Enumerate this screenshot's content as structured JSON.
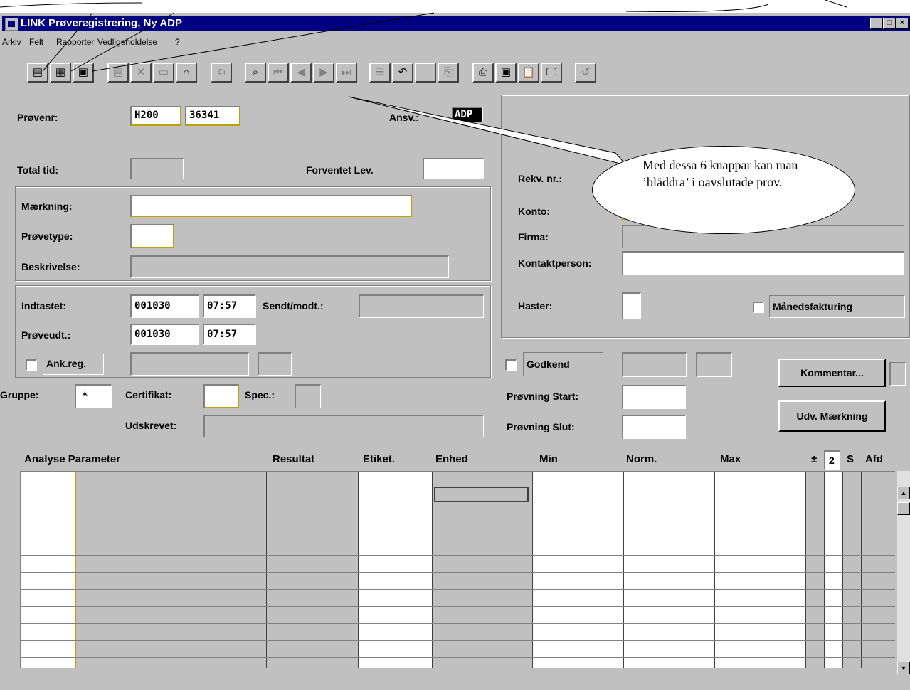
{
  "window": {
    "title": "LINK Prøveregistrering, Ny ADP",
    "menu": [
      "Arkiv",
      "Felt",
      "Rapporter",
      "Vedligeholdelse",
      "?"
    ]
  },
  "toolbar": {
    "buttons": [
      "new-doc",
      "calendar",
      "copy-sample",
      "edit",
      "delete",
      "save",
      "print-save",
      "duplicate",
      "search",
      "first",
      "previous",
      "next",
      "last",
      "list",
      "undo",
      "type",
      "copy",
      "printer",
      "disk",
      "clipboard",
      "monitor",
      "help"
    ]
  },
  "form": {
    "provenr_label": "Prøvenr:",
    "provenr_prefix": "H200",
    "provenr_number": "36341",
    "ansv_label": "Ansv.:",
    "ansv_value": "ADP",
    "total_tid_label": "Total tid:",
    "forventet_label": "Forventet Lev.",
    "maerkning_label": "Mærkning:",
    "provetype_label": "Prøvetype:",
    "beskrivelse_label": "Beskrivelse:",
    "indtastet_label": "Indtastet:",
    "indtastet_date": "001030",
    "indtastet_time": "07:57",
    "sendt_label": "Sendt/modt.:",
    "proveudt_label": "Prøveudt.:",
    "proveudt_date": "001030",
    "proveudt_time": "07:57",
    "ankreg_label": "Ank.reg.",
    "gruppe_label": "Gruppe:",
    "gruppe_value": "*",
    "certifikat_label": "Certifikat:",
    "spec_label": "Spec.:",
    "udskrevet_label": "Udskrevet:"
  },
  "right_panel": {
    "rekv_label": "Rekv. nr.:",
    "konto_label": "Konto:",
    "firma_label": "Firma:",
    "kontaktperson_label": "Kontaktperson:",
    "haster_label": "Haster:",
    "manedsfakturing_label": "Månedsfakturing",
    "godkend_label": "Godkend",
    "provning_start_label": "Prøvning Start:",
    "provning_slut_label": "Prøvning Slut:",
    "kommentar_button": "Kommentar...",
    "udv_button": "Udv. Mærkning"
  },
  "grid": {
    "headers": [
      "Analyse Parameter",
      "Resultat",
      "Etiket.",
      "Enhed",
      "Min",
      "Norm.",
      "Max",
      "±",
      "2",
      "S",
      "Afd"
    ],
    "row_count": 11
  },
  "annotation": {
    "text": "Med dessa 6 knappar kan man ’bläddra’ i oavslutade prov."
  }
}
